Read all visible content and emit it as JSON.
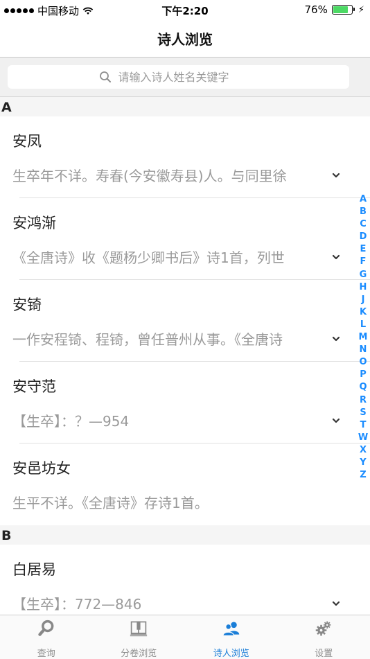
{
  "status_bar": {
    "carrier": "中国移动",
    "time": "下午2:20",
    "battery": "76%",
    "battery_level": 0.76
  },
  "nav": {
    "title": "诗人浏览"
  },
  "search": {
    "placeholder": "请输入诗人姓名关键字"
  },
  "sections": [
    {
      "letter": "A",
      "poets": [
        {
          "name": "安凤",
          "desc": "生卒年不详。寿春(今安徽寿县)人。与同里徐"
        },
        {
          "name": "安鸿渐",
          "desc": "《全唐诗》收《题杨少卿书后》诗1首，列世"
        },
        {
          "name": "安锜",
          "desc": "一作安程锜、程锜，曾任普州从事。《全唐诗"
        },
        {
          "name": "安守范",
          "desc": "【生卒】：？—954"
        },
        {
          "name": "安邑坊女",
          "desc": "生平不详。《全唐诗》存诗1首。"
        }
      ]
    },
    {
      "letter": "B",
      "poets": [
        {
          "name": "白居易",
          "desc": "【生卒】：772—846"
        }
      ]
    }
  ],
  "index": [
    "A",
    "B",
    "C",
    "D",
    "E",
    "F",
    "G",
    "H",
    "J",
    "K",
    "L",
    "M",
    "N",
    "O",
    "P",
    "Q",
    "R",
    "S",
    "T",
    "W",
    "X",
    "Y",
    "Z"
  ],
  "tabs": [
    {
      "label": "查询",
      "icon": "magnifier-icon"
    },
    {
      "label": "分卷浏览",
      "icon": "book-icon"
    },
    {
      "label": "诗人浏览",
      "icon": "people-icon"
    },
    {
      "label": "设置",
      "icon": "gears-icon"
    }
  ],
  "colors": {
    "accent": "#1a7ed8",
    "index": "#1a8cff",
    "battery": "#4cd964"
  }
}
